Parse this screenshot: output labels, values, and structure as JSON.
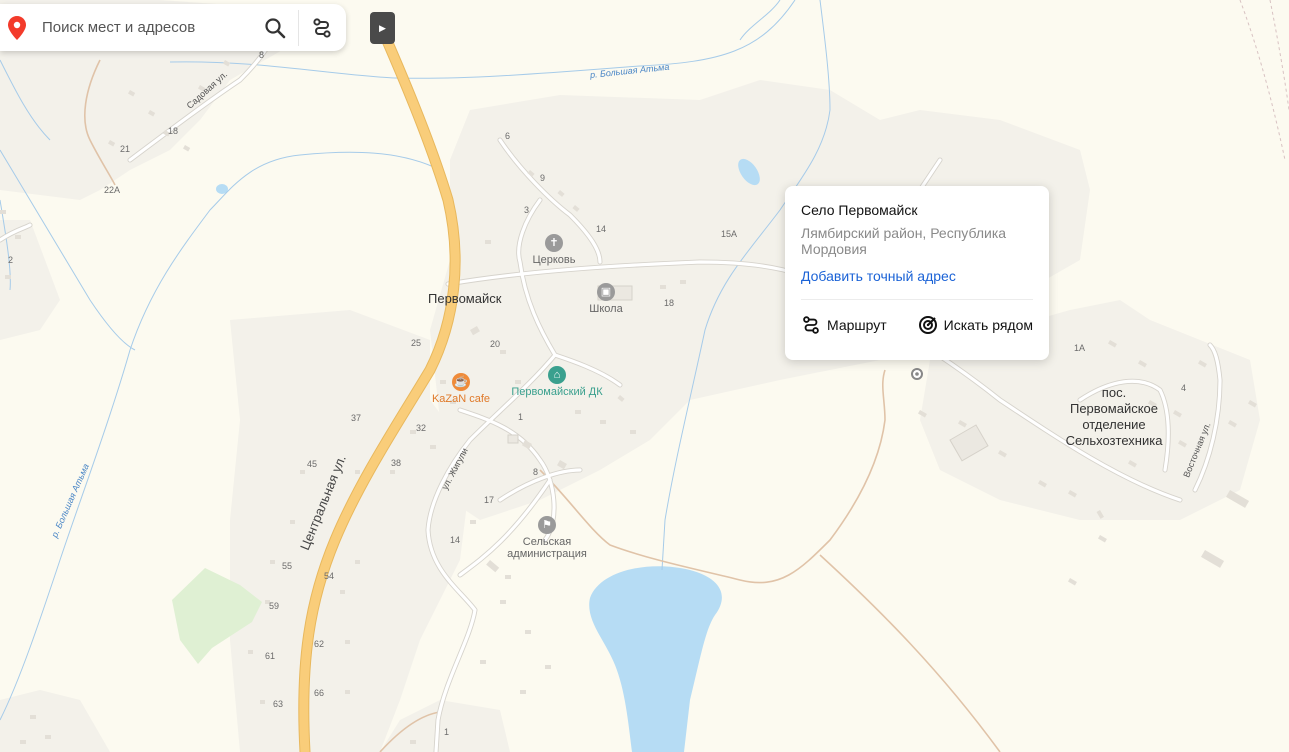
{
  "search": {
    "placeholder": "Поиск мест и адресов"
  },
  "popup": {
    "title": "Село Первомайск",
    "subtitle": "Лямбирский район, Республика Мордовия",
    "add_address_link": "Добавить точный адрес",
    "route_label": "Маршрут",
    "nearby_label": "Искать рядом"
  },
  "map": {
    "settlements": {
      "pervomaisk": "Первомайск",
      "pos_line1": "пос.",
      "pos_line2": "Первомайское",
      "pos_line3": "отделение",
      "pos_line4": "Сельхозтехника"
    },
    "pois": {
      "church": "Церковь",
      "school": "Школа",
      "dk": "Первомайский ДК",
      "cafe": "KaZaN cafe",
      "admin_line1": "Сельская",
      "admin_line2": "администрация"
    },
    "streets": {
      "central": "Центральная ул.",
      "sadovaya": "Садовая ул.",
      "zhiguli": "ул. Жигули",
      "vostochnaya": "Восточная ул."
    },
    "rivers": {
      "top": "р. Большая Атьма",
      "left": "р. Большая Атьма"
    },
    "house_numbers": [
      "8",
      "21",
      "18",
      "22А",
      "2",
      "6",
      "9",
      "3",
      "14",
      "15А",
      "18",
      "25",
      "20",
      "1",
      "37",
      "32",
      "45",
      "38",
      "8",
      "17",
      "14",
      "55",
      "54",
      "59",
      "62",
      "61",
      "66",
      "63",
      "1",
      "1А",
      "4"
    ]
  },
  "colors": {
    "background": "#fcfaf0",
    "main_road": "#f9cd7a",
    "water": "#b6dcf4",
    "park": "#dff0d3",
    "link": "#1a62d6",
    "pin": "#f33b2b"
  },
  "icons": {
    "search_pin": "location-pin-icon",
    "search": "search-icon",
    "route": "route-icon",
    "collapse": "collapse-arrow-icon",
    "nearby": "target-icon"
  }
}
